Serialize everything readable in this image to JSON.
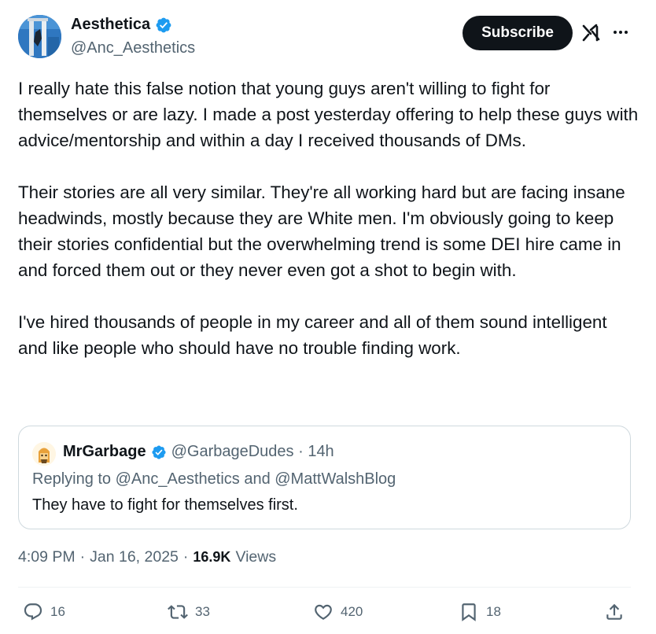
{
  "author": {
    "display_name": "Aesthetica",
    "handle": "@Anc_Aesthetics"
  },
  "header": {
    "subscribe_label": "Subscribe"
  },
  "tweet": {
    "paragraphs": [
      "I really hate this false notion that young guys aren't willing to fight for themselves or are lazy. I made a post yesterday offering to help these guys with advice/mentorship and within a day I received thousands of DMs.",
      "Their stories are all very similar. They're all working hard but are facing insane headwinds, mostly because they are White men. I'm obviously going to keep their stories confidential but the overwhelming trend is some DEI hire came in and forced them out or they never even got a shot to begin with.",
      "I've hired thousands of people in my career and all of them sound intelligent and like people who should have no trouble finding work."
    ]
  },
  "quote": {
    "display_name": "MrGarbage",
    "handle_time": "@GarbageDudes · 14h",
    "replying_to": "Replying to @Anc_Aesthetics and @MattWalshBlog",
    "text": "They have to fight for themselves first."
  },
  "meta": {
    "time": "4:09 PM",
    "date": "Jan 16, 2025",
    "views_count": "16.9K",
    "views_label": "Views",
    "separator": "·"
  },
  "actions": {
    "replies": "16",
    "reposts": "33",
    "likes": "420",
    "bookmarks": "18"
  },
  "colors": {
    "text_primary": "#0f1419",
    "text_secondary": "#536471",
    "verified_blue": "#1d9bf0",
    "border": "#cfd9de",
    "subscribe_bg": "#0f1419"
  },
  "icons": {
    "verified": "verified-badge-icon",
    "grok": "grok-icon",
    "more": "more-icon",
    "reply": "reply-icon",
    "retweet": "retweet-icon",
    "like": "heart-icon",
    "bookmark": "bookmark-icon",
    "share": "share-icon"
  }
}
